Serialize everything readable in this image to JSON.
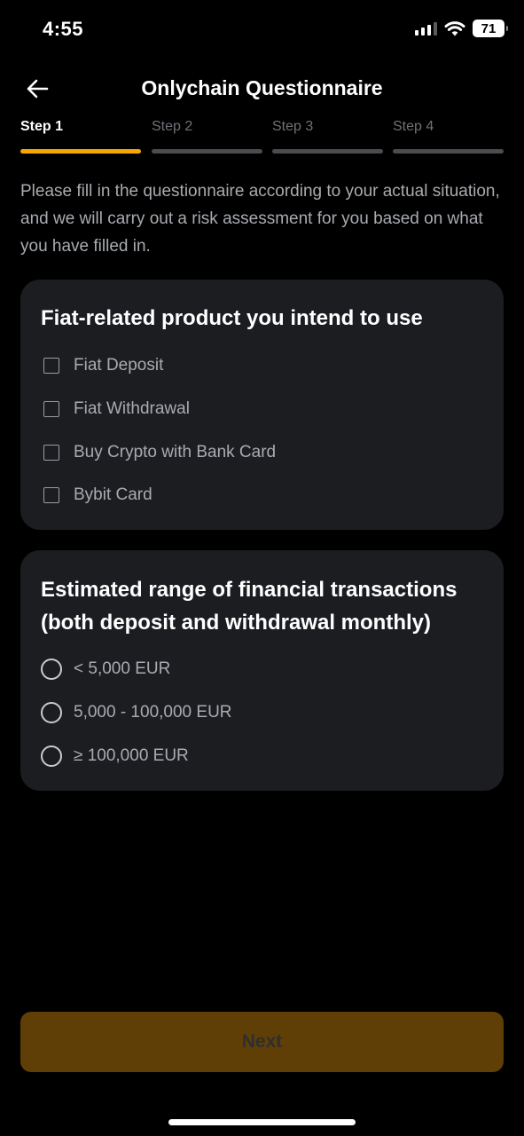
{
  "status_bar": {
    "time": "4:55",
    "battery": "71"
  },
  "header": {
    "title": "Onlychain Questionnaire",
    "back_icon": "arrow-left-icon"
  },
  "steps": [
    {
      "label": "Step 1",
      "active": true
    },
    {
      "label": "Step 2",
      "active": false
    },
    {
      "label": "Step 3",
      "active": false
    },
    {
      "label": "Step 4",
      "active": false
    }
  ],
  "intro": "Please fill in the questionnaire according to your actual situation, and we will carry out a risk assessment for you based on what you have filled in.",
  "section_products": {
    "title": "Fiat-related product you intend to use",
    "options": [
      {
        "label": "Fiat Deposit",
        "checked": false
      },
      {
        "label": "Fiat Withdrawal",
        "checked": false
      },
      {
        "label": "Buy Crypto with Bank Card",
        "checked": false
      },
      {
        "label": "Bybit Card",
        "checked": false
      }
    ]
  },
  "section_range": {
    "title": "Estimated range of financial transactions (both deposit and withdrawal monthly)",
    "options": [
      {
        "label": "< 5,000 EUR",
        "selected": false
      },
      {
        "label": "5,000 - 100,000 EUR",
        "selected": false
      },
      {
        "label": "≥ 100,000 EUR",
        "selected": false
      }
    ]
  },
  "next_button": {
    "label": "Next",
    "enabled": false
  },
  "colors": {
    "accent": "#f7a600",
    "card_bg": "#1c1d21",
    "button_disabled_bg": "#5f3f06",
    "inactive_bar": "#4a4c50"
  }
}
